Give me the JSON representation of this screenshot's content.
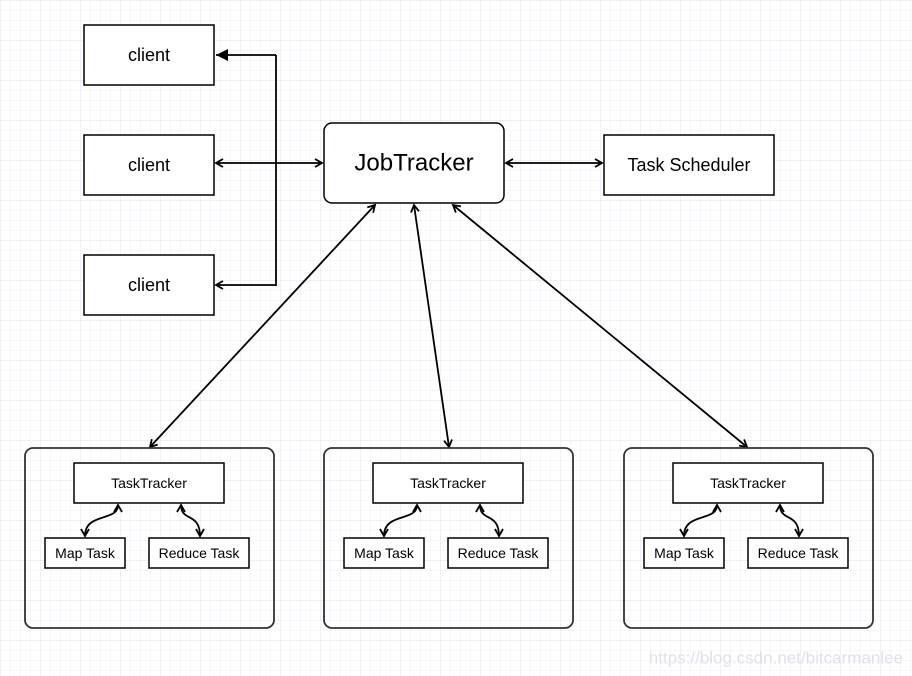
{
  "clients": [
    "client",
    "client",
    "client"
  ],
  "job_tracker": "JobTracker",
  "task_scheduler": "Task Scheduler",
  "nodes": [
    {
      "tracker": "TaskTracker",
      "map": "Map Task",
      "reduce": "Reduce Task"
    },
    {
      "tracker": "TaskTracker",
      "map": "Map Task",
      "reduce": "Reduce Task"
    },
    {
      "tracker": "TaskTracker",
      "map": "Map Task",
      "reduce": "Reduce Task"
    }
  ],
  "watermark": "https://blog.csdn.net/bitcarmanlee",
  "colors": {
    "grid_minor": "#f0f0fa",
    "grid_major": "#e2e2f4",
    "stroke": "#000000"
  }
}
